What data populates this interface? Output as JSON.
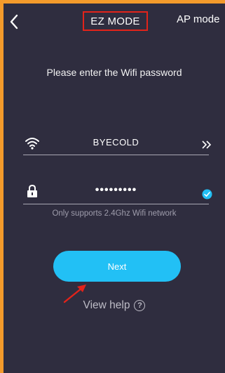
{
  "header": {
    "ez_mode_label": "EZ MODE",
    "ap_mode_label": "AP mode"
  },
  "main": {
    "prompt": "Please enter the Wifi password",
    "wifi_name": "BYECOLD",
    "password_masked": "•••••••••",
    "hint": "Only supports 2.4Ghz Wifi network",
    "next_label": "Next",
    "help_label": "View help",
    "help_icon_glyph": "?"
  },
  "icons": {
    "back": "chevron-left-icon",
    "wifi": "wifi-icon",
    "more": "double-chevron-right-icon",
    "lock": "lock-icon",
    "check": "check-circle-icon",
    "help": "question-circle-icon"
  },
  "colors": {
    "frame": "#f39a2b",
    "background": "#2f2d3f",
    "accent": "#22c0f5",
    "highlight_box": "#e2231a"
  }
}
